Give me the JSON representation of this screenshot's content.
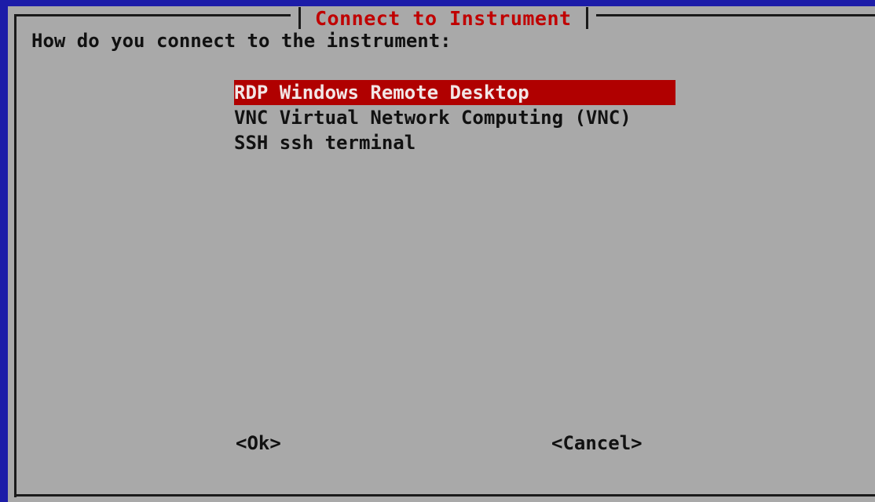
{
  "dialog": {
    "title": "Connect to Instrument",
    "prompt": "How do you connect to the instrument:",
    "options": [
      {
        "label": "RDP Windows Remote Desktop",
        "selected": true
      },
      {
        "label": "VNC Virtual Network Computing (VNC)",
        "selected": false
      },
      {
        "label": "SSH ssh terminal",
        "selected": false
      }
    ],
    "ok_label": "<Ok>",
    "cancel_label": "<Cancel>"
  },
  "colors": {
    "screen_background": "#1c1ca8",
    "dialog_background": "#a9a9a9",
    "title_text": "#c00000",
    "selection_background": "#b00000"
  }
}
